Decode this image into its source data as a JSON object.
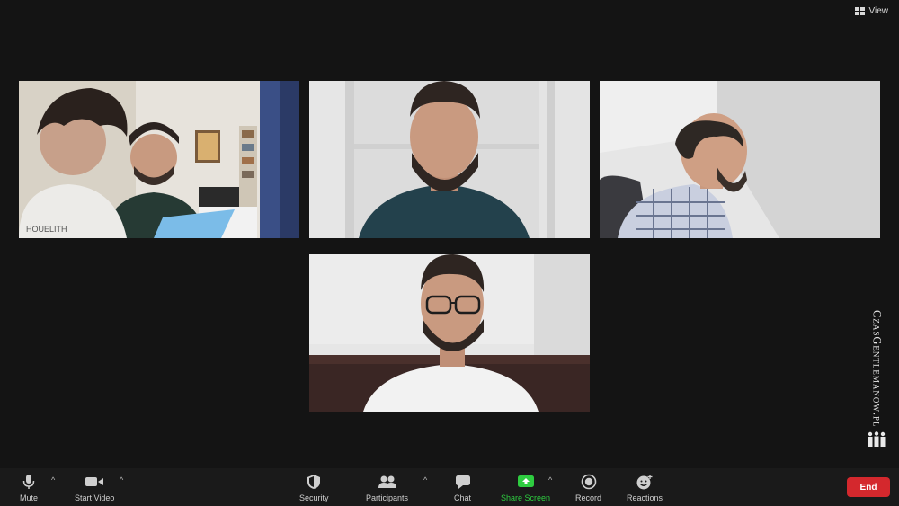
{
  "header": {
    "view_label": "View"
  },
  "participants": [
    {
      "id": "p1",
      "description": "boy and man in dark shirt reading paper"
    },
    {
      "id": "p2",
      "description": "man with beard in teal sweater"
    },
    {
      "id": "p3",
      "description": "man in checked shirt seen in profile"
    },
    {
      "id": "p4",
      "description": "man with glasses in white t-shirt"
    }
  ],
  "watermark": {
    "text": "CzasGentlemanow.pl"
  },
  "toolbar": {
    "mute_label": "Mute",
    "start_video_label": "Start Video",
    "security_label": "Security",
    "participants_label": "Participants",
    "chat_label": "Chat",
    "share_screen_label": "Share Screen",
    "record_label": "Record",
    "reactions_label": "Reactions",
    "end_label": "End",
    "caret": "^"
  },
  "colors": {
    "background": "#141414",
    "toolbar": "#1a1a1a",
    "share_green": "#2ecc40",
    "end_red": "#d4282d"
  }
}
